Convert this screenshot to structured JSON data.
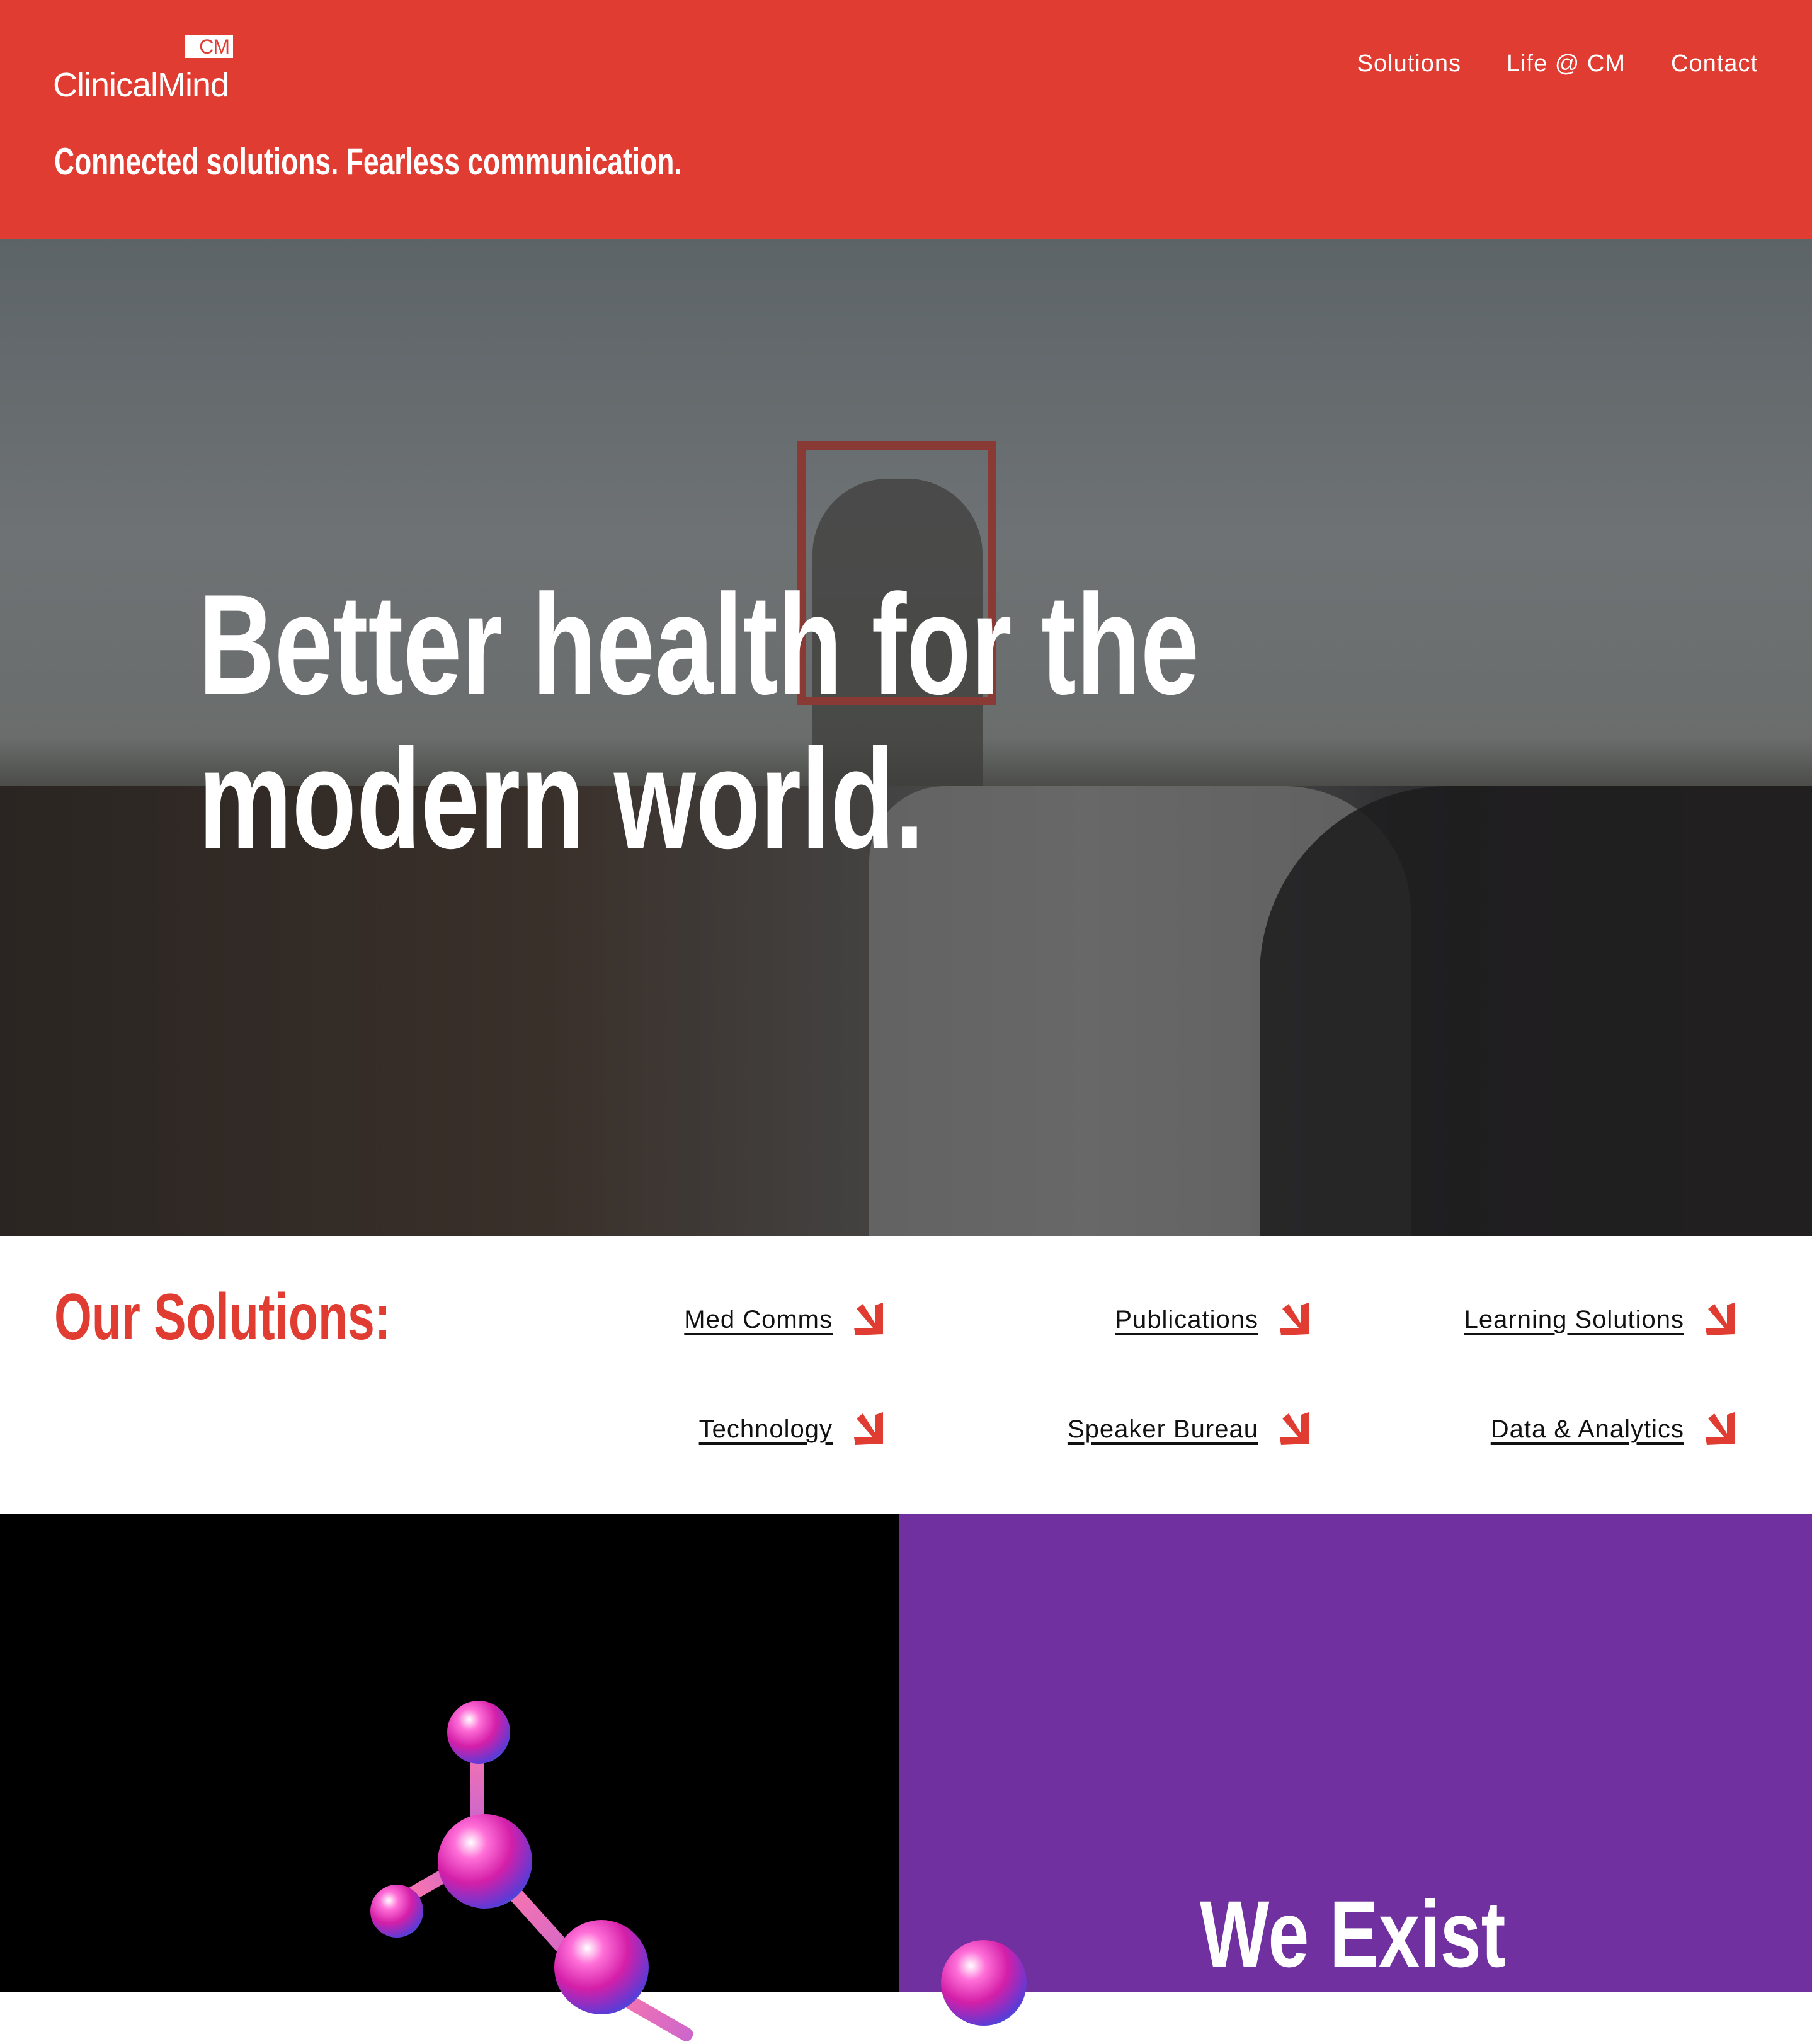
{
  "header": {
    "logo_badge": "CM",
    "logo_text": "ClinicalMind",
    "tagline": "Connected solutions. Fearless communication.",
    "nav": [
      "Solutions",
      "Life @ CM",
      "Contact"
    ]
  },
  "hero": {
    "line1": "Better health for the",
    "line2": "modern world."
  },
  "solutions": {
    "title": "Our Solutions:",
    "links": [
      "Med Comms",
      "Publications",
      "Learning Solutions",
      "Technology",
      "Speaker Bureau",
      "Data & Analytics"
    ]
  },
  "exist": {
    "title": "We Exist"
  },
  "colors": {
    "brand_red": "#e03c31",
    "purple": "#7030a0"
  }
}
